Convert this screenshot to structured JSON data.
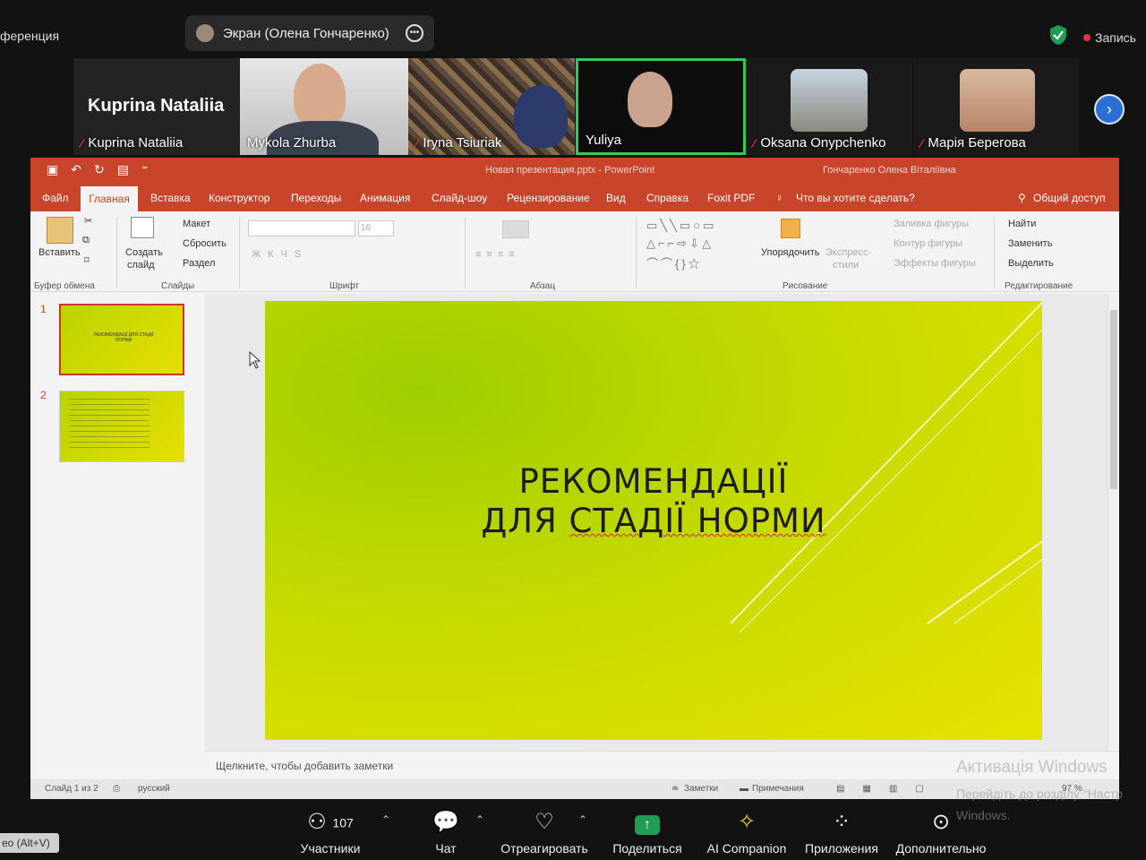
{
  "zoom": {
    "conference_label": "ференция",
    "screen_share_label": "Экран (Олена Гончаренко)",
    "record_label": "Запись",
    "participants": [
      {
        "name": "Kuprina Nataliia",
        "big_name": "Kuprina Nataliia",
        "muted": true
      },
      {
        "name": "Mykola Zhurba",
        "muted": false
      },
      {
        "name": "Iryna Tsiuriak",
        "muted": true
      },
      {
        "name": "Yuliya",
        "muted": false,
        "active": true
      },
      {
        "name": "Oksana Onypchenko",
        "muted": true
      },
      {
        "name": "Марія Берегова",
        "muted": true
      }
    ],
    "toolbar": {
      "participants_label": "Участники",
      "participants_count": "107",
      "chat_label": "Чат",
      "react_label": "Отреагировать",
      "share_label": "Поделиться",
      "ai_label": "AI Companion",
      "apps_label": "Приложения",
      "more_label": "Дополнительно"
    },
    "alt_v_label": "eo (Alt+V)"
  },
  "powerpoint": {
    "title": "Новая презентация.pptx  -  PowerPoint",
    "user": "Гончаренко Олена Віталіївна",
    "menu": [
      "Файл",
      "Главная",
      "Вставка",
      "Конструктор",
      "Переходы",
      "Анимация",
      "Слайд-шоу",
      "Рецензирование",
      "Вид",
      "Справка",
      "Foxit PDF"
    ],
    "tell_me": "Что вы хотите сделать?",
    "share": "Общий доступ",
    "ribbon": {
      "paste": "Вставить",
      "clipboard": "Буфер обмена",
      "new_slide_1": "Создать",
      "new_slide_2": "слайд",
      "layout": "Макет",
      "reset": "Сбросить",
      "section": "Раздел",
      "slides": "Слайды",
      "font_size": "16",
      "font": "Шрифт",
      "paragraph": "Абзац",
      "arrange": "Упорядочить",
      "quick_styles_1": "Экспресс-",
      "quick_styles_2": "стили",
      "shape_fill": "Заливка фигуры",
      "shape_outline": "Контур фигуры",
      "shape_effects": "Эффекты фигуры",
      "drawing": "Рисование",
      "find": "Найти",
      "replace": "Заменить",
      "select": "Выделить",
      "editing": "Редактирование"
    },
    "slide_title_line1": "РЕКОМЕНДАЦІЇ",
    "slide_title_line2_a": "ДЛЯ ",
    "slide_title_line2_b": "СТАДІЇ НОРМИ",
    "thumb1_num": "1",
    "thumb2_num": "2",
    "thumb1_text": "РЕКОМЕНДАЦІЇ ДЛЯ СТАДІЇ НОРМИ",
    "notes_placeholder": "Щелкните, чтобы добавить заметки",
    "status_slide": "Слайд 1 из 2",
    "status_lang": "русский",
    "status_notes": "Заметки",
    "status_comments": "Примечания",
    "zoom_pct": "97 %"
  },
  "watermark": {
    "line1": "Активація Windows",
    "line2": "Перейдіть до розділу \"Настр",
    "line3": "Windows."
  },
  "colors": {
    "ppt_accent": "#c8442a",
    "zoom_share": "#1f9d55",
    "active_speaker": "#35c759"
  }
}
